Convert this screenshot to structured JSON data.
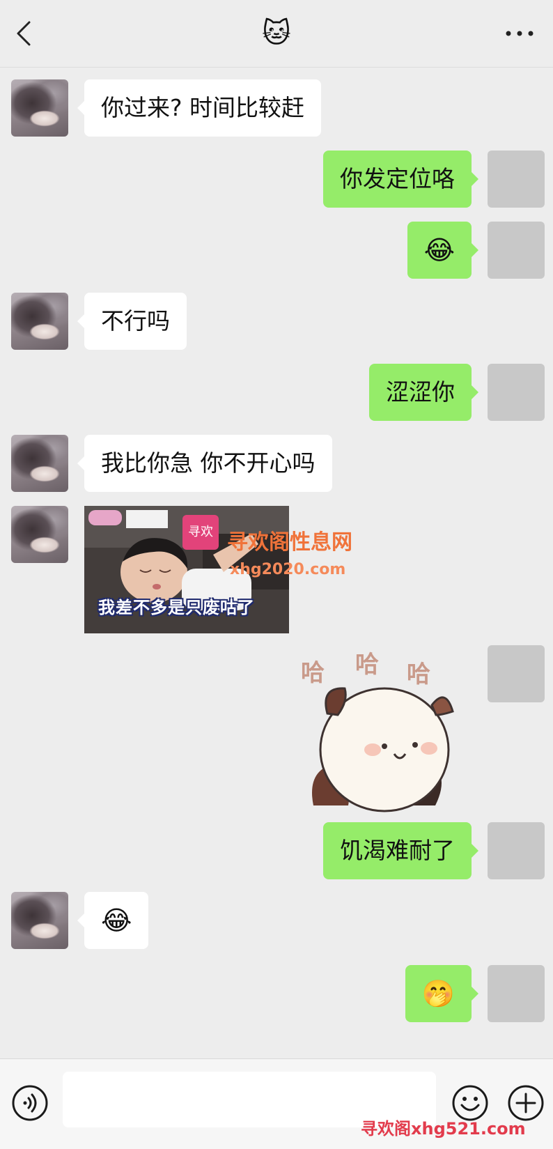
{
  "header": {
    "title_emoji": "🐱",
    "back_icon": "chevron-left-icon",
    "more_icon": "more-dots-icon"
  },
  "messages": [
    {
      "side": "left",
      "type": "text",
      "text": "你过来? 时间比较赶"
    },
    {
      "side": "right",
      "type": "text",
      "text": "你发定位咯"
    },
    {
      "side": "right",
      "type": "emoji",
      "text": "😂"
    },
    {
      "side": "left",
      "type": "text",
      "text": "不行吗"
    },
    {
      "side": "right",
      "type": "text",
      "text": "涩涩你"
    },
    {
      "side": "left",
      "type": "text",
      "text": "我比你急 你不开心吗"
    },
    {
      "side": "left",
      "type": "image",
      "caption": "我差不多是只废咕了"
    },
    {
      "side": "right",
      "type": "sticker",
      "texts": [
        "哈",
        "哈",
        "哈"
      ]
    },
    {
      "side": "right",
      "type": "text",
      "text": "饥渴难耐了"
    },
    {
      "side": "left",
      "type": "emoji",
      "text": "😂"
    },
    {
      "side": "right",
      "type": "emoji",
      "text": "🤭"
    }
  ],
  "watermark": {
    "site_name": "寻欢阁性息网",
    "site_url": "xhg2020.com",
    "logo_text": "寻欢",
    "bottom_text": "寻欢阁xhg521.com"
  },
  "input_bar": {
    "placeholder": "",
    "voice_icon": "voice-icon",
    "emoji_icon": "smiley-icon",
    "plus_icon": "plus-icon"
  },
  "colors": {
    "background": "#ededed",
    "bubble_self": "#95ec69",
    "bubble_other": "#ffffff",
    "avatar_self_placeholder": "#c8c8c8"
  }
}
